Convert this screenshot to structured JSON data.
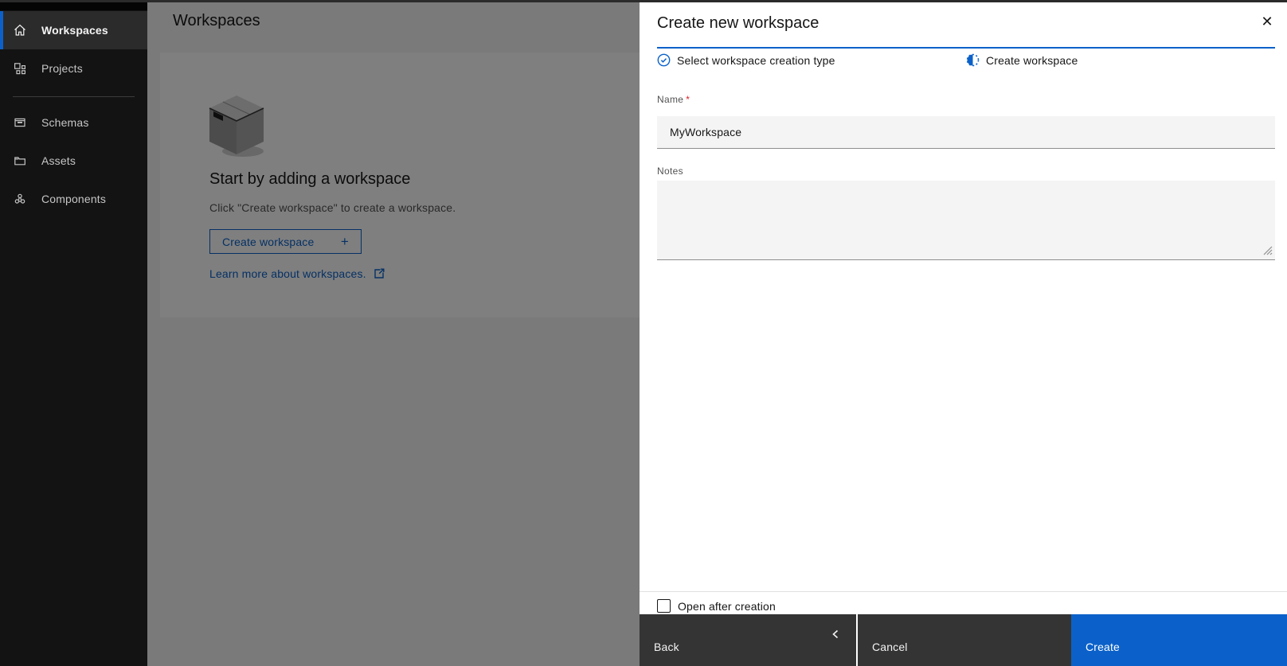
{
  "colors": {
    "accent": "#0b61c9",
    "danger": "#da1e28",
    "sidebar_bg": "#131313",
    "panel_bg": "#ffffff",
    "field_bg": "#f4f4f4",
    "secondary_button_bg": "#343434",
    "overlay": "rgba(0,0,0,0.5)"
  },
  "icons": [
    "home-icon",
    "projects-icon",
    "schemas-icon",
    "assets-icon",
    "components-icon",
    "step-complete-icon",
    "step-current-icon",
    "close-icon",
    "plus-icon",
    "launch-icon",
    "chevron-left-icon",
    "resize-grip-icon",
    "box-illustration"
  ],
  "sidebar": {
    "items": [
      {
        "label": "Workspaces",
        "icon": "home-icon",
        "active": true
      },
      {
        "label": "Projects",
        "icon": "projects-icon",
        "active": false
      },
      {
        "label": "Schemas",
        "icon": "schemas-icon",
        "active": false
      },
      {
        "label": "Assets",
        "icon": "assets-icon",
        "active": false
      },
      {
        "label": "Components",
        "icon": "components-icon",
        "active": false
      }
    ]
  },
  "main": {
    "title": "Workspaces",
    "empty_state": {
      "heading": "Start by adding a workspace",
      "description": "Click \"Create workspace\" to create a workspace.",
      "create_button_label": "Create workspace",
      "create_button_plus": "+",
      "learn_more_label": "Learn more about workspaces."
    }
  },
  "panel": {
    "title": "Create new workspace",
    "close_icon": "✕",
    "steps": [
      {
        "label": "Select workspace creation type",
        "state": "complete"
      },
      {
        "label": "Create workspace",
        "state": "current"
      }
    ],
    "name_field": {
      "label": "Name",
      "required_indicator": "*",
      "value": "MyWorkspace"
    },
    "notes_field": {
      "label": "Notes",
      "value": ""
    },
    "checkbox": {
      "label": "Open after creation",
      "checked": false
    },
    "footer_buttons": {
      "back": "Back",
      "cancel": "Cancel",
      "create": "Create"
    }
  }
}
